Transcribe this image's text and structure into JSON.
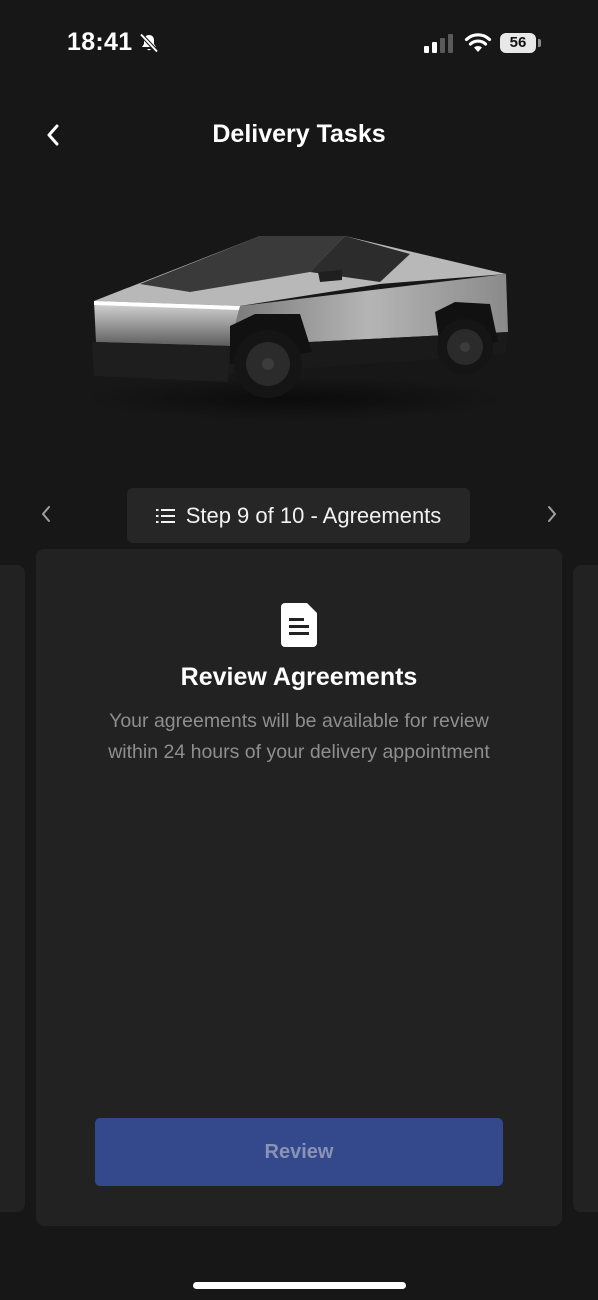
{
  "status_bar": {
    "time": "18:41",
    "battery": "56",
    "icons": [
      "bell-slash-icon",
      "cellular-signal-icon",
      "wifi-icon",
      "battery-icon"
    ]
  },
  "header": {
    "title": "Delivery Tasks",
    "back_icon": "chevron-left-icon"
  },
  "vehicle": {
    "image": "cybertruck-illustration"
  },
  "step_nav": {
    "label": "Step 9 of 10 - Agreements",
    "list_icon": "list-icon",
    "prev_icon": "chevron-left-icon",
    "next_icon": "chevron-right-icon"
  },
  "card": {
    "icon": "document-icon",
    "title": "Review Agreements",
    "description": "Your agreements will be available for review within 24 hours of your delivery appointment",
    "button_label": "Review"
  },
  "colors": {
    "background": "#171717",
    "card": "#222222",
    "button": "#33498b",
    "button_text": "#8893b6",
    "muted_text": "#8e8e8e"
  }
}
